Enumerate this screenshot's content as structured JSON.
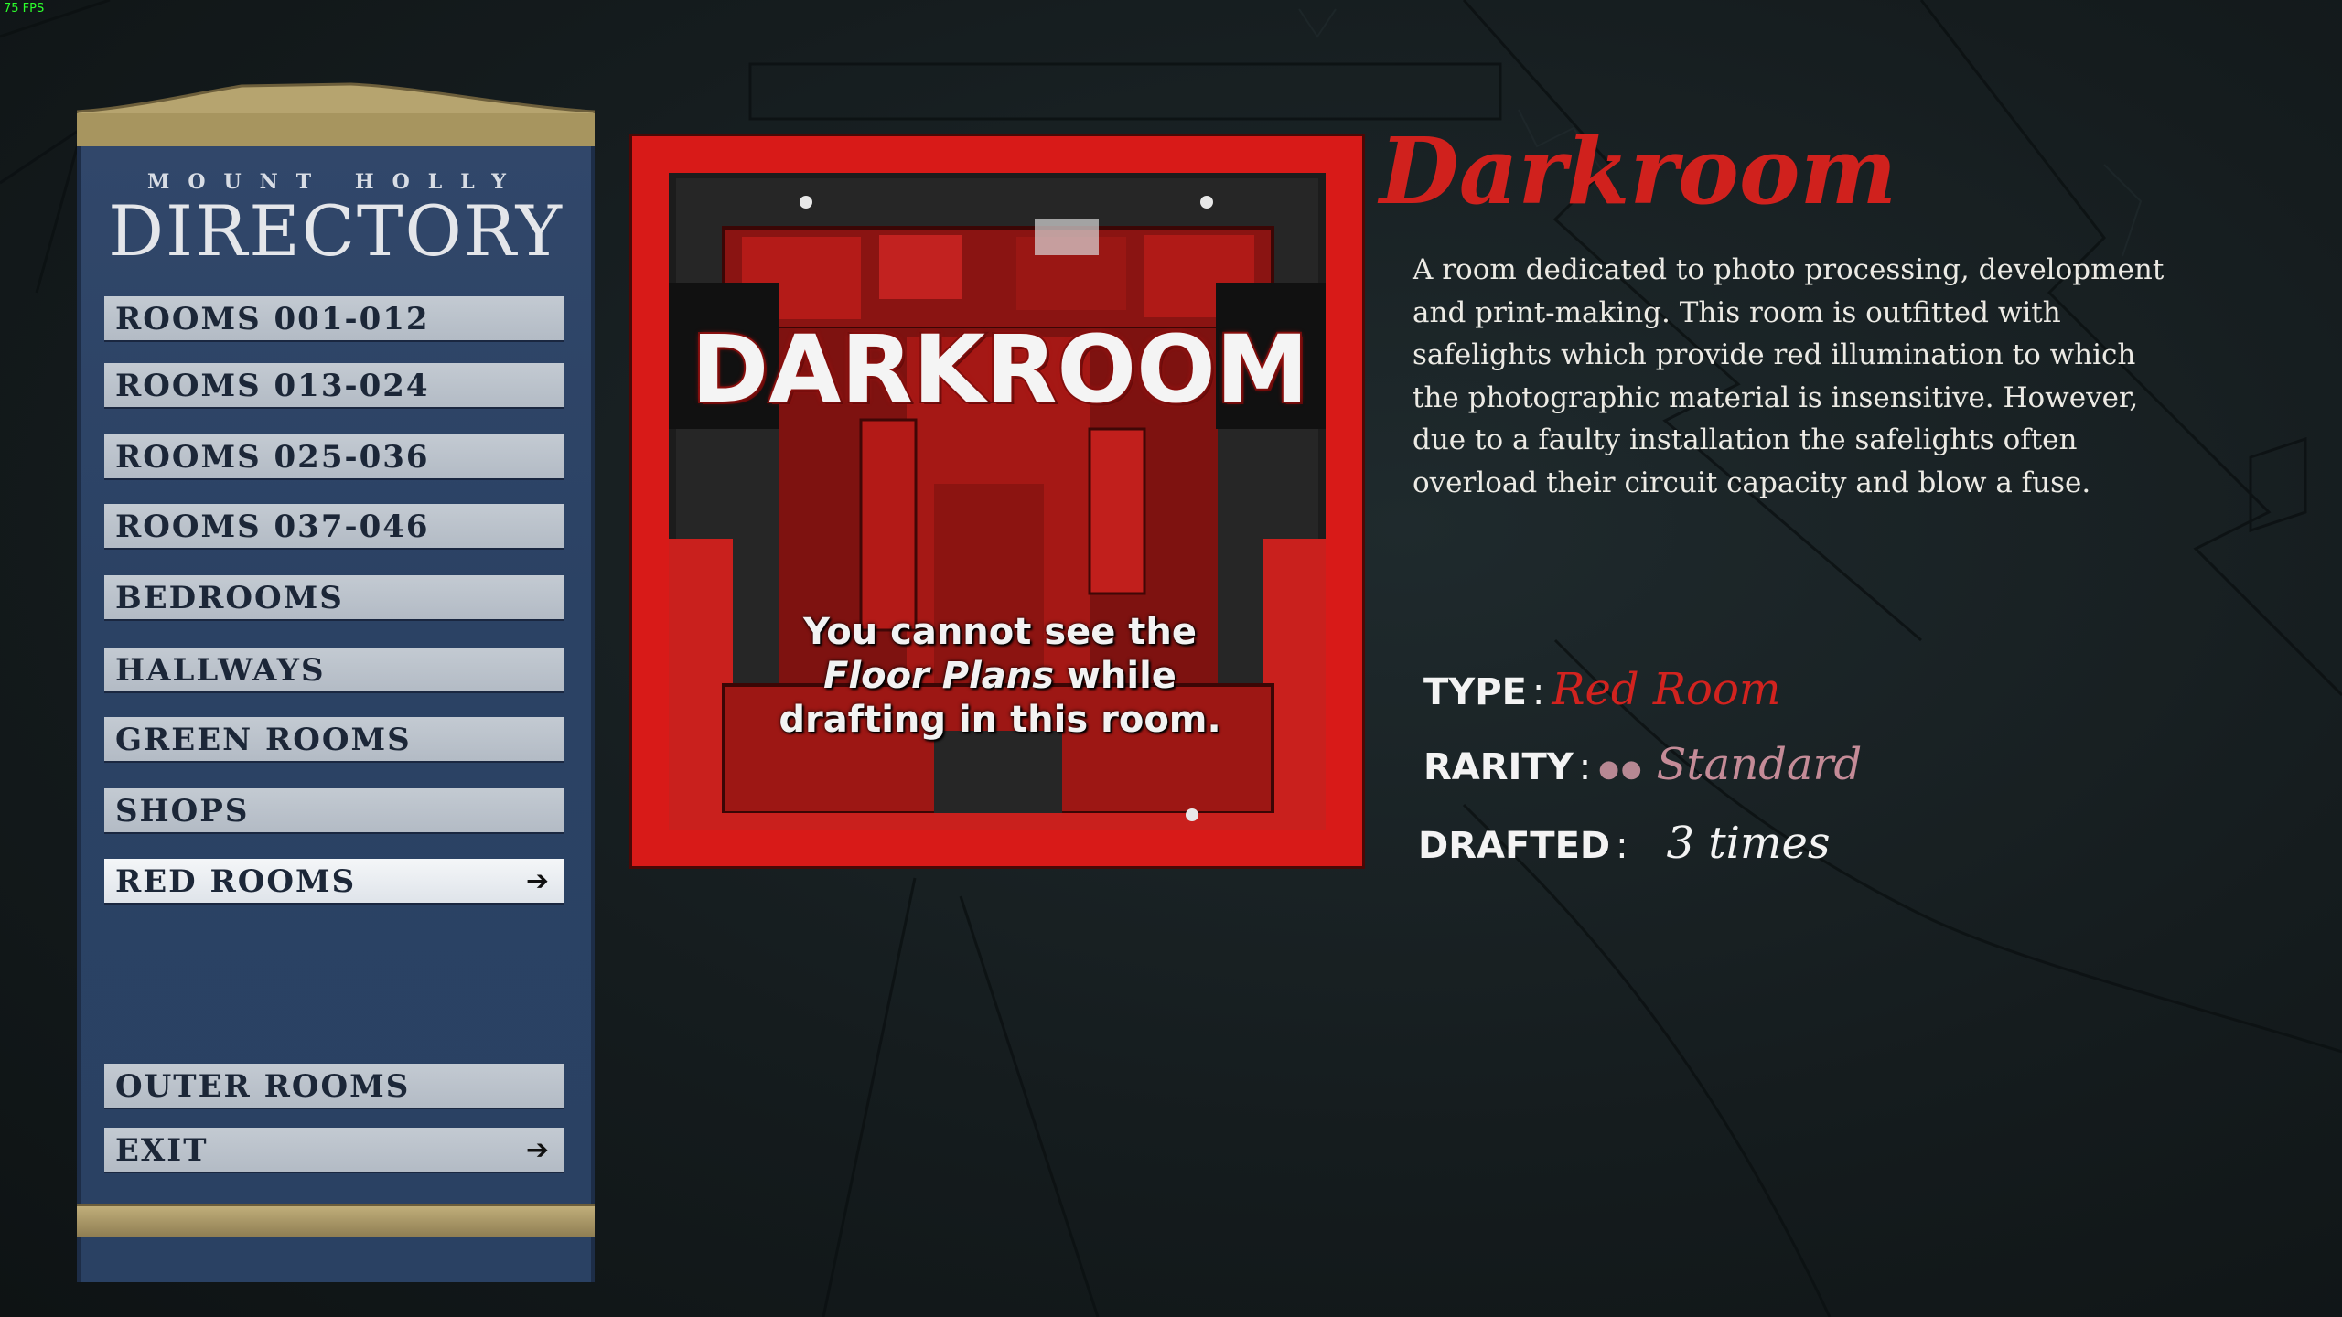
{
  "fps": "75 FPS",
  "directory": {
    "subtitle": "MOUNT HOLLY",
    "title": "DIRECTORY",
    "items": [
      {
        "label": "ROOMS 001-012"
      },
      {
        "label": "ROOMS 013-024"
      },
      {
        "label": "ROOMS 025-036"
      },
      {
        "label": "ROOMS 037-046"
      },
      {
        "label": "BEDROOMS"
      },
      {
        "label": "HALLWAYS"
      },
      {
        "label": "GREEN ROOMS"
      },
      {
        "label": "SHOPS"
      },
      {
        "label": "RED ROOMS",
        "active": true
      },
      {
        "label": "OUTER ROOMS"
      },
      {
        "label": "EXIT"
      }
    ]
  },
  "room": {
    "image_title": "DARKROOM",
    "note_pre": "You cannot see the",
    "note_em": "Floor Plans",
    "note_mid": " while",
    "note_post": "drafting in this room."
  },
  "info": {
    "name": "Darkroom",
    "description": "A room dedicated to photo processing, development and print-making. This room is outfitted with safelights which provide red illumination to which the photographic material is insensitive. However, due to a faulty installation the safelights often overload their circuit capacity and blow a fuse.",
    "type_label": "TYPE",
    "type_value": "Red Room",
    "rarity_label": "RARITY",
    "rarity_dots": "●●",
    "rarity_value": "Standard",
    "drafted_label": "DRAFTED",
    "drafted_value": "3 times"
  },
  "colors": {
    "accent_red": "#d0211d",
    "type_red": "#d2231f",
    "rarity_pink": "#c48b97",
    "board_blue": "#2b4264"
  }
}
